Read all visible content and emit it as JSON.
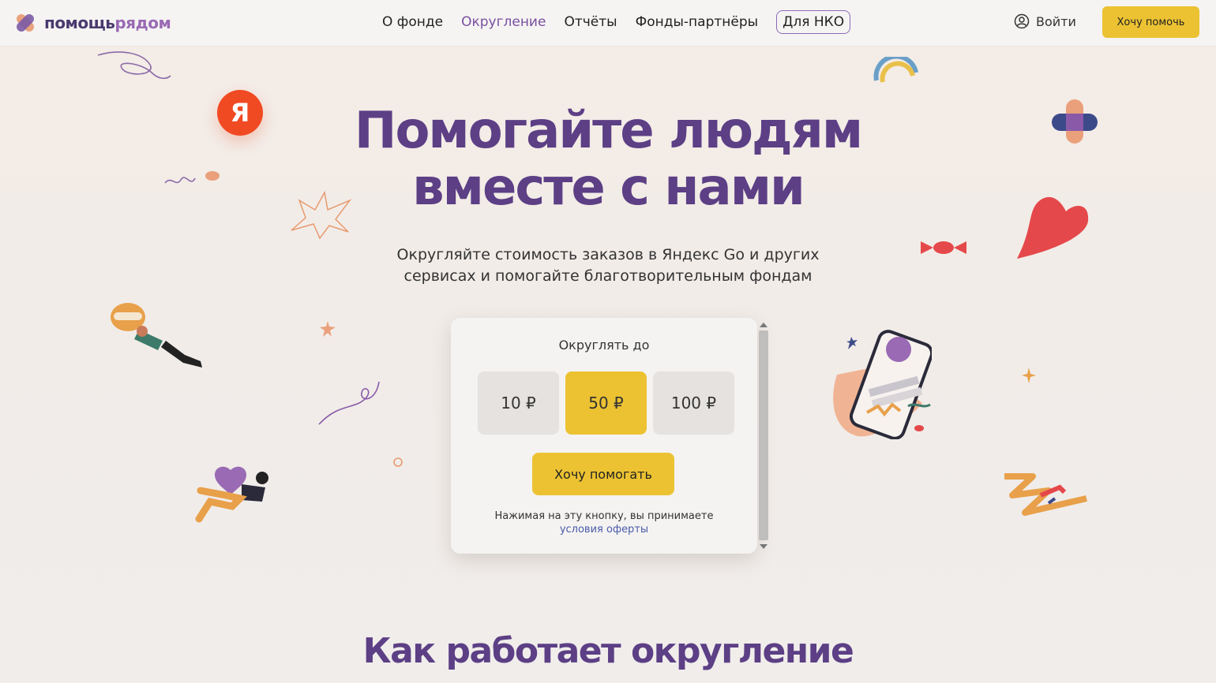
{
  "header": {
    "logo": {
      "part1": "помощь",
      "part2": "рядом"
    },
    "nav": [
      {
        "label": "О фонде",
        "active": false
      },
      {
        "label": "Округление",
        "active": true
      },
      {
        "label": "Отчёты",
        "active": false
      },
      {
        "label": "Фонды-партнёры",
        "active": false
      },
      {
        "label": "Для НКО",
        "active": false
      }
    ],
    "login_label": "Войти",
    "help_button": "Хочу помочь"
  },
  "hero": {
    "title_line1": "Помогайте людям",
    "title_line2": "вместе с нами",
    "subtitle_line1": "Округляйте стоимость заказов в Яндекс Go и других",
    "subtitle_line2": "сервисах и помогайте благотворительным фондам",
    "badge": "Я"
  },
  "rounding_card": {
    "label": "Округлять до",
    "options": [
      "10 ₽",
      "50 ₽",
      "100 ₽"
    ],
    "selected": "50 ₽",
    "cta": "Хочу помогать",
    "terms_text": "Нажимая на эту кнопку, вы принимаете",
    "terms_link": "условия оферты"
  },
  "section": {
    "title": "Как работает округление"
  },
  "colors": {
    "accent_yellow": "#ecc232",
    "brand_purple": "#5c3f85",
    "yandex_red": "#f04a23"
  }
}
